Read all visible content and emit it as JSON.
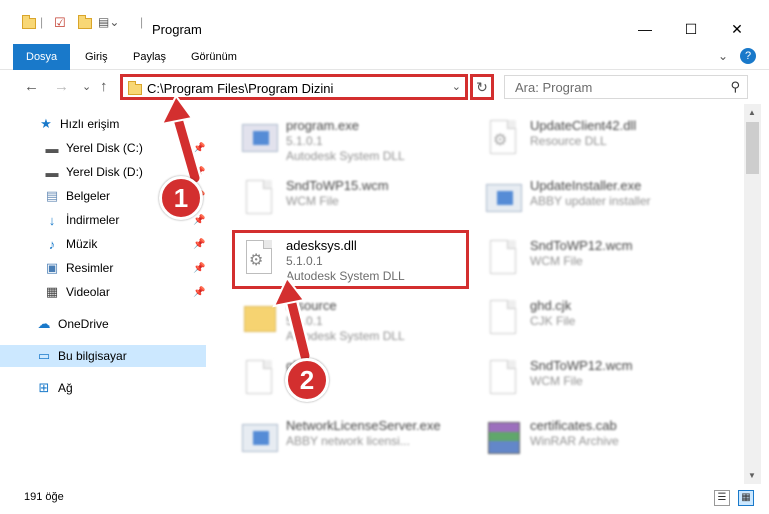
{
  "window": {
    "title": "Program",
    "minimize": "—",
    "maximize": "☐",
    "close": "✕"
  },
  "ribbon": {
    "tabs": [
      "Dosya",
      "Giriş",
      "Paylaş",
      "Görünüm"
    ],
    "help": "?",
    "expand": "⌄"
  },
  "nav": {
    "back": "←",
    "forward": "→",
    "recent": "⌄",
    "up": "↑",
    "address_path": "C:\\Program Files\\Program Dizini",
    "address_drop": "⌄",
    "refresh": "↻",
    "search_placeholder": "Ara: Program",
    "search_icon": "⚲"
  },
  "sidebar": {
    "items": [
      {
        "label": "Hızlı erişim",
        "icon": "star-icon"
      },
      {
        "label": "Yerel Disk (C:)",
        "icon": "drive-icon"
      },
      {
        "label": "Yerel Disk (D:)",
        "icon": "drive-icon"
      },
      {
        "label": "Belgeler",
        "icon": "documents-icon"
      },
      {
        "label": "İndirmeler",
        "icon": "download-icon"
      },
      {
        "label": "Müzik",
        "icon": "music-icon"
      },
      {
        "label": "Resimler",
        "icon": "pictures-icon"
      },
      {
        "label": "Videolar",
        "icon": "videos-icon"
      },
      {
        "label": "OneDrive",
        "icon": "cloud-icon"
      },
      {
        "label": "Bu bilgisayar",
        "icon": "computer-icon"
      },
      {
        "label": "Ağ",
        "icon": "network-icon"
      }
    ]
  },
  "files": [
    {
      "name": "program.exe",
      "line2": "5.1.0.1",
      "line3": "Autodesk System DLL"
    },
    {
      "name": "UpdateClient42.dll",
      "line2": "Resource DLL",
      "line3": ""
    },
    {
      "name": "SndToWP15.wcm",
      "line2": "WCM File",
      "line3": ""
    },
    {
      "name": "UpdateInstaller.exe",
      "line2": "ABBY updater installer",
      "line3": ""
    },
    {
      "name": "adesksys.dll",
      "line2": "5.1.0.1",
      "line3": "Autodesk System DLL"
    },
    {
      "name": "SndToWP12.wcm",
      "line2": "WCM File",
      "line3": ""
    },
    {
      "name": "resource",
      "line2": "5.1.0.1",
      "line3": "Autodesk System DLL"
    },
    {
      "name": "ghd.cjk",
      "line2": "CJK File",
      "line3": ""
    },
    {
      "name": "ghdat",
      "line2": "",
      "line3": ""
    },
    {
      "name": "SndToWP12.wcm",
      "line2": "WCM File",
      "line3": ""
    },
    {
      "name": "NetworkLicenseServer.exe",
      "line2": "ABBY network licensi...",
      "line3": ""
    },
    {
      "name": "certificates.cab",
      "line2": "WinRAR Archive",
      "line3": ""
    }
  ],
  "status": {
    "count": "191 öğe"
  },
  "annotations": {
    "marker1": "1",
    "marker2": "2"
  },
  "colors": {
    "accent": "#1979ca",
    "highlight": "#d32f2f",
    "selection": "#cce8ff"
  }
}
